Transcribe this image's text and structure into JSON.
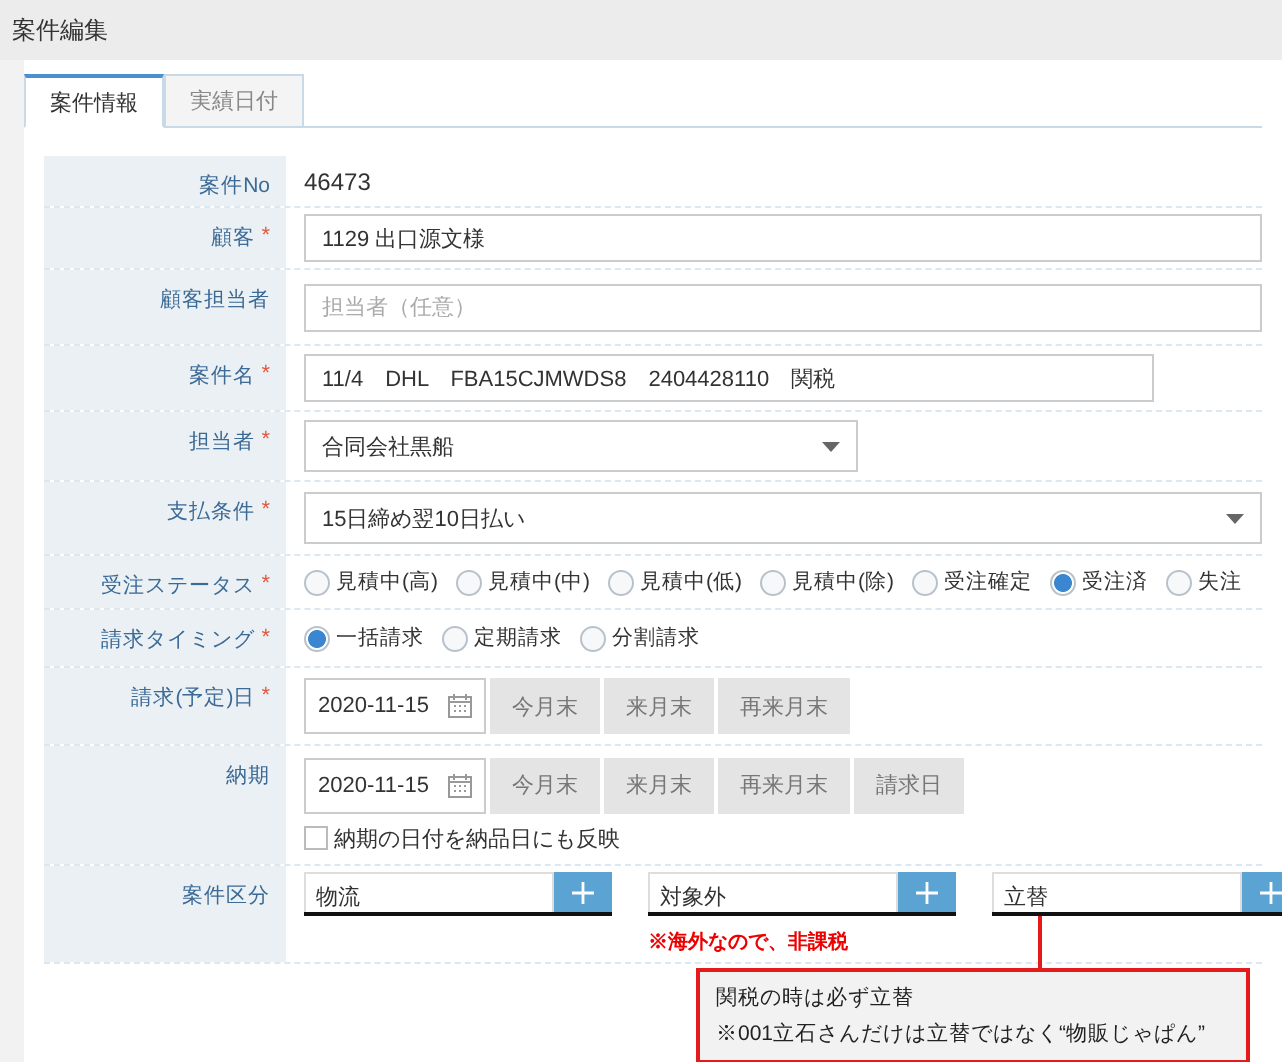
{
  "window": {
    "title": "案件編集"
  },
  "tabs": [
    {
      "label": "案件情報",
      "selected": true
    },
    {
      "label": "実績日付",
      "selected": false
    }
  ],
  "fields": [
    {
      "kind": "text",
      "label": "案件No",
      "value": "46473"
    },
    {
      "kind": "input",
      "label": "顧客",
      "required_mark": "*",
      "value": "1129 出口源文様"
    },
    {
      "kind": "input",
      "label": "顧客担当者",
      "placeholder": "担当者（任意）"
    },
    {
      "kind": "input",
      "label": "案件名",
      "required_mark": "*",
      "value": "11/4　DHL　FBA15CJMWDS8　2404428110　関税"
    },
    {
      "kind": "select",
      "label": "担当者",
      "required_mark": "*",
      "value": "合同会社黒船"
    },
    {
      "kind": "select",
      "label": "支払条件",
      "required_mark": "*",
      "value": "15日締め翌10日払い"
    },
    {
      "kind": "radio",
      "label": "受注ステータス",
      "required_mark": "*",
      "options": [
        {
          "label": "見積中(高)",
          "selected": false
        },
        {
          "label": "見積中(中)",
          "selected": false
        },
        {
          "label": "見積中(低)",
          "selected": false
        },
        {
          "label": "見積中(除)",
          "selected": false
        },
        {
          "label": "受注確定",
          "selected": false
        },
        {
          "label": "受注済",
          "selected": true
        },
        {
          "label": "失注",
          "selected": false
        }
      ]
    },
    {
      "kind": "radio",
      "label": "請求タイミング",
      "required_mark": "*",
      "options": [
        {
          "label": "一括請求",
          "selected": true
        },
        {
          "label": "定期請求",
          "selected": false
        },
        {
          "label": "分割請求",
          "selected": false
        }
      ]
    },
    {
      "kind": "date",
      "label": "請求(予定)日",
      "required_mark": "*",
      "value": "2020-11-15",
      "buttons": [
        "今月末",
        "来月末",
        "再来月末"
      ]
    },
    {
      "kind": "date",
      "label": "納期",
      "value": "2020-11-15",
      "buttons": [
        "今月末",
        "来月末",
        "再来月末",
        "請求日"
      ],
      "checkbox": {
        "label": "納期の日付を納品日にも反映",
        "checked": false
      }
    },
    {
      "kind": "category",
      "label": "案件区分",
      "values": [
        "物流",
        "対象外",
        "立替"
      ],
      "note": "※海外なので、非課税"
    }
  ],
  "annotation": {
    "lines": [
      "関税の時は必ず立替",
      "※001立石さんだけは立替ではなく“物販じゃぱん”"
    ]
  }
}
